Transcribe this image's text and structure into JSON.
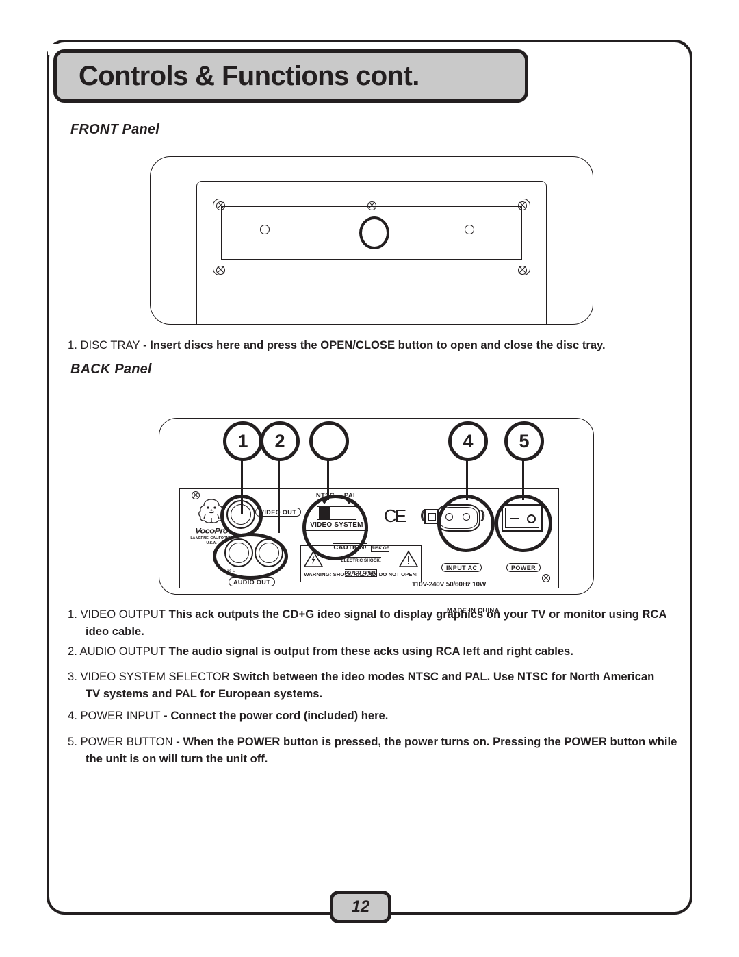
{
  "header": {
    "title": "Controls & Functions cont."
  },
  "footer": {
    "page_number": "12"
  },
  "sections": {
    "front_heading": "FRONT Panel",
    "back_heading": "BACK Panel"
  },
  "front_items": [
    {
      "number": "1.",
      "term": "DISC TRAY",
      "dash": " - ",
      "desc_a": "Insert discs here and press the ",
      "desc_b": "OPEN/CLOSE",
      "desc_c": " button to open and close the disc tray."
    }
  ],
  "back_items": [
    {
      "number": "1.",
      "term": "VIDEO OUTPUT",
      "gap": "    ",
      "desc_a": "This   ack outputs the ",
      "desc_b": "CD+G",
      "desc_c": "   ideo signal to display graphics on your TV or monitor using ",
      "desc_d": "RCA",
      "line2": "ideo cable."
    },
    {
      "number": "2.",
      "term": "AUDIO OUTPUT",
      "gap": "    ",
      "desc_a": "The audio signal is output from these   acks using ",
      "desc_b": "RCA",
      "desc_c": " left and right cables."
    },
    {
      "number": "3.",
      "term": "VIDEO SYSTEM SELECTOR",
      "gap": "    ",
      "desc_a": "Switch between the   ideo modes ",
      "desc_b": "NTSC",
      "desc_c": " and ",
      "desc_d": "PAL",
      "desc_e": ". Use ",
      "desc_f": "NTSC",
      "desc_g": " for North American",
      "line2_a": "TV systems and ",
      "line2_b": "PAL",
      "line2_c": " for European systems."
    },
    {
      "number": "4.",
      "term": "POWER INPUT",
      "dash": " - ",
      "desc_a": "Connect the power cord (included) here."
    },
    {
      "number": "5.",
      "term": "POWER BUTTON",
      "dash": "  - ",
      "desc_a": "When the ",
      "desc_b": "POWER",
      "desc_c": " button is pressed, the power turns on. Pressing the ",
      "desc_d": "POWER",
      "desc_e": " button while",
      "line2": "the unit is on will turn the unit off."
    }
  ],
  "back_panel": {
    "brand_name": "VocoPro",
    "brand_city_line1": "LA VERNE, CALIFORNIA",
    "brand_city_line2": "U.S.A.",
    "video_out_label": "VIDEO OUT",
    "audio_out_label": "AUDIO OUT",
    "audio_hint": "R                L",
    "video_system": {
      "ntsc_label": "NTSC",
      "pal_label": "PAL",
      "title": "VIDEO SYSTEM"
    },
    "caution": {
      "title": "CAUTION!",
      "body_line1": "RISK OF ELECTRIC SHOCK.",
      "body_line2": "DO NOT OPEN!",
      "footer": "WARNING: SHOCK HAZARD. DO NOT OPEN!"
    },
    "ce_mark": "CE",
    "input_ac_label": "INPUT AC",
    "power_label": "POWER",
    "rating": "110V-240V   50/60Hz 10W",
    "made_in": "MADE IN CHINA"
  },
  "callouts": [
    {
      "label": "1"
    },
    {
      "label": "2"
    },
    {
      "label": ""
    },
    {
      "label": "4"
    },
    {
      "label": "5"
    }
  ]
}
